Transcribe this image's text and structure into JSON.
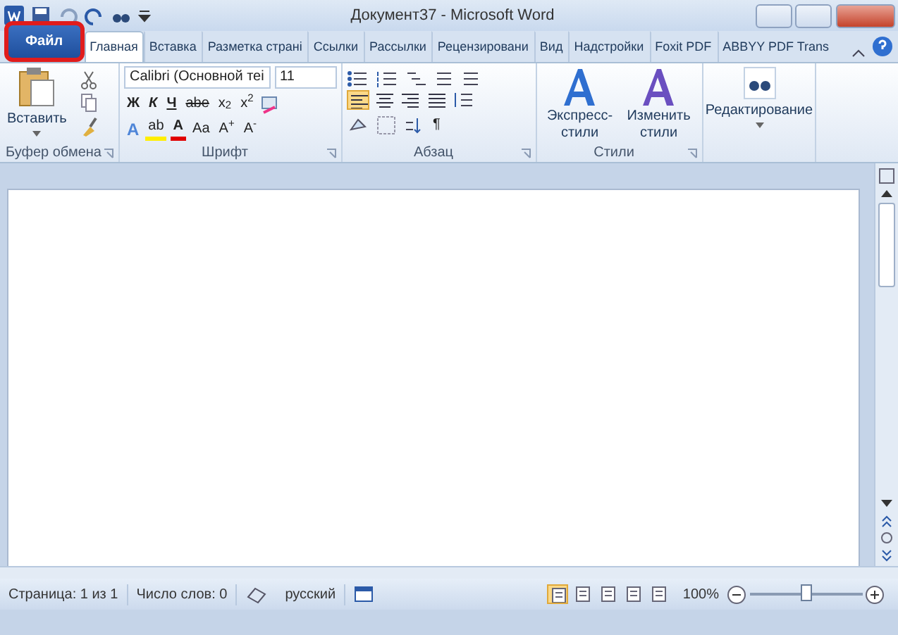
{
  "window": {
    "title": "Документ37  -  Microsoft Word"
  },
  "tabs": [
    {
      "label": "Файл",
      "kind": "file",
      "selected": false,
      "highlighted": true
    },
    {
      "label": "Главная",
      "kind": "tab",
      "selected": true
    },
    {
      "label": "Вставка",
      "kind": "tab",
      "selected": false
    },
    {
      "label": "Разметка страні",
      "kind": "tab",
      "selected": false
    },
    {
      "label": "Ссылки",
      "kind": "tab",
      "selected": false
    },
    {
      "label": "Рассылки",
      "kind": "tab",
      "selected": false
    },
    {
      "label": "Рецензировани",
      "kind": "tab",
      "selected": false
    },
    {
      "label": "Вид",
      "kind": "tab",
      "selected": false
    },
    {
      "label": "Надстройки",
      "kind": "tab",
      "selected": false
    },
    {
      "label": "Foxit PDF",
      "kind": "tab",
      "selected": false
    },
    {
      "label": "ABBYY PDF Trans",
      "kind": "tab",
      "selected": false
    }
  ],
  "clipboard": {
    "paste_label": "Вставить",
    "group_label": "Буфер обмена"
  },
  "font": {
    "font_name": "Calibri (Основной теі",
    "font_size": "11",
    "group_label": "Шрифт",
    "format_buttons": [
      {
        "label": "Ж",
        "kind": "bold"
      },
      {
        "label": "К",
        "kind": "italic"
      },
      {
        "label": "Ч",
        "kind": "underline"
      },
      {
        "label": "abe",
        "kind": "strike"
      },
      {
        "label": "x$_{2}$",
        "kind": "plain"
      },
      {
        "label": "x$^{2}$",
        "kind": "plain"
      }
    ],
    "color_buttons": [
      {
        "label": "A",
        "kind": "effects"
      },
      {
        "label": "ab",
        "kind": "highlight"
      },
      {
        "label": "A",
        "kind": "color"
      },
      {
        "label": "Aa",
        "kind": "plain"
      },
      {
        "label": "A$^{+}$",
        "kind": "plain"
      },
      {
        "label": "A$^{-}$",
        "kind": "plain"
      }
    ]
  },
  "paragraph": {
    "group_label": "Абзац",
    "alignments": [
      {
        "selected": true
      },
      {
        "selected": false
      },
      {
        "selected": false
      },
      {
        "selected": false
      }
    ],
    "pilcrow": "¶"
  },
  "styles": {
    "express_label": "Экспресс-стили",
    "change_label": "Изменить стили",
    "group_label": "Стили"
  },
  "editing": {
    "label": "Редактирование"
  },
  "status_bar": {
    "page": "Страница: 1 из 1",
    "words": "Число слов: 0",
    "language": "русский",
    "zoom": "100%",
    "views": [
      {
        "selected": true
      },
      {
        "selected": false
      },
      {
        "selected": false
      },
      {
        "selected": false
      },
      {
        "selected": false
      }
    ],
    "zoom_slider": {
      "level": 0.5
    }
  }
}
